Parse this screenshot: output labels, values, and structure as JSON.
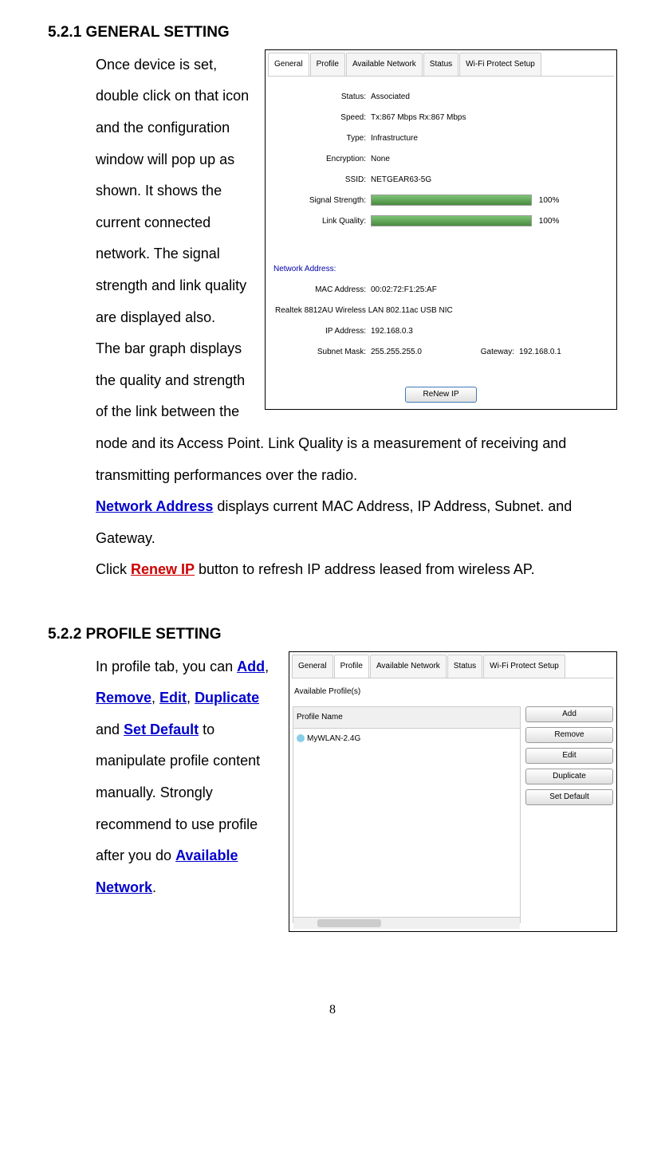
{
  "section1": {
    "heading": "5.2.1 GENERAL SETTING",
    "para1a": "Once device is set, double click on that icon and the configuration window will pop up as shown. It shows the current connected network. The signal strength and link quality are displayed also.",
    "para1b": "The bar graph displays the quality and strength of the link between the node and its Access Point. Link Quality is a measurement of receiving and transmitting performances over the radio.",
    "network_address_label": "Network Address",
    "para2": " displays current MAC Address, IP Address, Subnet. and Gateway.",
    "para3a": "Click ",
    "renew_ip_label": "Renew IP",
    "para3b": " button to refresh IP address leased from wireless AP."
  },
  "section2": {
    "heading": "5.2.2 PROFILE SETTING",
    "para_a": "In profile tab, you can ",
    "add": "Add",
    "comma1": ", ",
    "remove": "Remove",
    "comma2": ", ",
    "edit": "Edit",
    "comma3": ", ",
    "duplicate": "Duplicate",
    "and": " and ",
    "set_default": "Set Default",
    "para_b": " to manipulate profile content manually. Strongly recommend to use profile after you do ",
    "available_network": "Available Network",
    "period": "."
  },
  "screenshot1": {
    "tabs": [
      "General",
      "Profile",
      "Available Network",
      "Status",
      "Wi-Fi Protect Setup"
    ],
    "fields": {
      "status_label": "Status:",
      "status_value": "Associated",
      "speed_label": "Speed:",
      "speed_value": "Tx:867 Mbps Rx:867 Mbps",
      "type_label": "Type:",
      "type_value": "Infrastructure",
      "encryption_label": "Encryption:",
      "encryption_value": "None",
      "ssid_label": "SSID:",
      "ssid_value": "NETGEAR63-5G",
      "signal_label": "Signal Strength:",
      "signal_percent": "100%",
      "link_label": "Link Quality:",
      "link_percent": "100%"
    },
    "network": {
      "section_label": "Network Address:",
      "mac_label": "MAC Address:",
      "mac_value": "00:02:72:F1:25:AF",
      "adapter_label": "Realtek 8812AU Wireless LAN 802.11ac USB NIC",
      "ip_label": "IP Address:",
      "ip_value": "192.168.0.3",
      "subnet_label": "Subnet Mask:",
      "subnet_value": "255.255.255.0",
      "gateway_label": "Gateway:",
      "gateway_value": "192.168.0.1"
    },
    "renew_button": "ReNew IP"
  },
  "screenshot2": {
    "tabs": [
      "General",
      "Profile",
      "Available Network",
      "Status",
      "Wi-Fi Protect Setup"
    ],
    "group_label": "Available Profile(s)",
    "profile_header": "Profile Name",
    "profile_item": "MyWLAN-2.4G",
    "buttons": {
      "add": "Add",
      "remove": "Remove",
      "edit": "Edit",
      "duplicate": "Duplicate",
      "set_default": "Set Default"
    }
  },
  "page_number": "8"
}
